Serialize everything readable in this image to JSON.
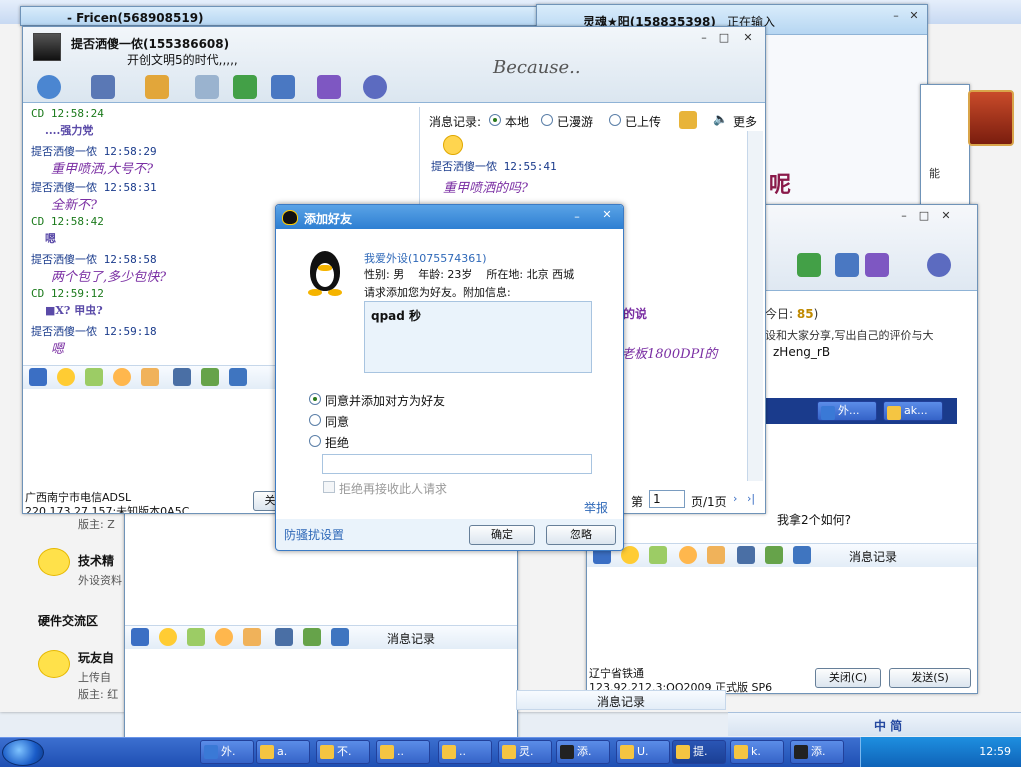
{
  "colors": {
    "accent": "#2e7fd2",
    "chat_name": "#1a3b8c",
    "chat_msg": "#7a2ea3",
    "taskbar": "#2a5bc2"
  },
  "chat1": {
    "title": "提否洒傻一侬(155386608)",
    "status": "开创文明5的时代,,,,,",
    "lines": [
      {
        "name": "CD  12:58:24",
        "msg": "....强力党",
        "green": true,
        "msg_plain": true
      },
      {
        "name": "提否洒傻一侬  12:58:29",
        "msg": "重甲喷洒,大号不?"
      },
      {
        "name": "提否洒傻一侬  12:58:31",
        "msg": "全新不?"
      },
      {
        "name": "CD  12:58:42",
        "msg": "嗯",
        "green": true,
        "msg_plain": true
      },
      {
        "name": "提否洒傻一侬  12:58:58",
        "msg": "两个包了,多少包快?"
      },
      {
        "name": "CD  12:59:12",
        "msg": "■X? 甲虫?",
        "green": true,
        "msg_plain": true
      },
      {
        "name": "提否洒傻一侬  12:59:18",
        "msg": "嗯"
      }
    ],
    "footer_line1": "广西南宁市电信ADSL",
    "footer_line2": "220.173.27.157:未知版本0A5C",
    "close_btn": "关"
  },
  "history": {
    "label": "消息记录:",
    "opt_local": "本地",
    "opt_roam": "已漫游",
    "opt_upload": "已上传",
    "more": "更多",
    "entry_name": "提否洒傻一侬 12:55:41",
    "entry_msg": "重甲喷洒的吗?",
    "page_label": "第",
    "page_value": "1",
    "page_total": "页/1页"
  },
  "chat2": {
    "title": "灵魂★阳(158835398)",
    "status": "正在输入",
    "footer_line1": "辽宁省铁通",
    "footer_line2": "123.92.212.3:QQ2009 正式版 SP6",
    "close_btn": "关闭(C)",
    "send_btn": "发送(S)",
    "msg_record": "消息记录"
  },
  "chat0": {
    "title": "- Fricen(568908519)"
  },
  "forum": {
    "today_label": "今日:",
    "today_value": "85",
    "desc": "设和大家分享,写出自己的评价与大",
    "user": "zHeng_rB",
    "tail_text": "我拿2个如何?",
    "word_ne": "呢",
    "word_neng": "能",
    "moderator1": "版主: Z",
    "sec_tech": "技术精",
    "sec_tech_sub": "外设资料",
    "sec_hw": "硬件交流区",
    "sec_fun": "玩友自",
    "sec_fun_sub": "上传自",
    "moderator2": "版主: 红",
    "speech": "的说",
    "board": "老板1800DPI的"
  },
  "dialog": {
    "title": "添加好友",
    "requester": "我爱外设(1075574361)",
    "sex_label": "性别: 男",
    "age_label": "年龄: 23岁",
    "location": "所在地: 北京  西城",
    "request_text": "请求添加您为好友。附加信息:",
    "message": "qpad 秒",
    "opt_agree_add": "同意并添加对方为好友",
    "opt_agree": "同意",
    "opt_reject": "拒绝",
    "block_label": "拒绝再接收此人请求",
    "report": "举报",
    "anti_spam": "防骚扰设置",
    "ok": "确定",
    "ignore": "忽略"
  },
  "taskbar": {
    "tasks": [
      "外.",
      "a.",
      "不.",
      "..",
      "..",
      "灵.",
      "添.",
      "U.",
      "提.",
      "k.",
      "添."
    ],
    "clock": "12:59",
    "ime": "中 简",
    "mini_tasks": [
      "外...",
      "ak..."
    ]
  }
}
